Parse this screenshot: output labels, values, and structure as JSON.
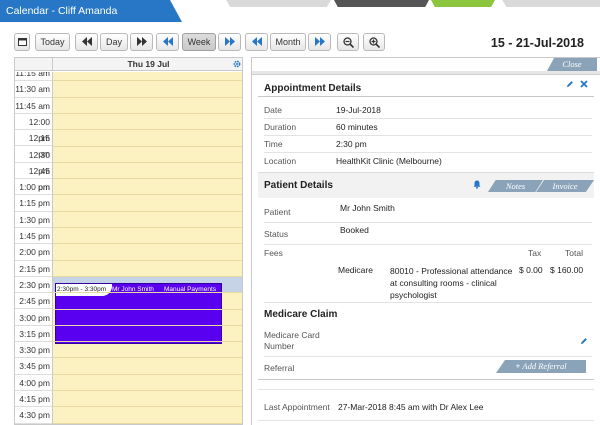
{
  "header": {
    "title": "Calendar - Cliff Amanda"
  },
  "toolbar": {
    "today_label": "Today",
    "day_label": "Day",
    "week_label": "Week",
    "month_label": "Month",
    "date_range": "15 - 21-Jul-2018"
  },
  "calendar": {
    "day_header": "Thu 19 Jul",
    "times": [
      "11:15 am",
      "11:30 am",
      "11:45 am",
      "12:00 pm",
      "12:15 pm",
      "12:30 pm",
      "12:45 pm",
      "1:00 pm",
      "1:15 pm",
      "1:30 pm",
      "1:45 pm",
      "2:00 pm",
      "2:15 pm",
      "2:30 pm",
      "2:45 pm",
      "3:00 pm",
      "3:15 pm",
      "3:30 pm",
      "3:45 pm",
      "4:00 pm",
      "4:15 pm",
      "4:30 pm"
    ],
    "appointment": {
      "time": "2:30pm - 3:30pm",
      "patient": "Mr John Smith",
      "payment": "Manual Payments",
      "color": "#5a00f0"
    }
  },
  "details": {
    "close_label": "Close",
    "appointment_title": "Appointment Details",
    "date_label": "Date",
    "date_value": "19-Jul-2018",
    "duration_label": "Duration",
    "duration_value": "60 minutes",
    "time_label": "Time",
    "time_value": "2:30 pm",
    "location_label": "Location",
    "location_value": "HealthKit Clinic (Melbourne)",
    "patient_title": "Patient Details",
    "notes_label": "Notes",
    "invoice_label": "Invoice",
    "patient_label": "Patient",
    "patient_value": "Mr John Smith",
    "status_label": "Status",
    "status_value": "Booked",
    "fees_label": "Fees",
    "tax_header": "Tax",
    "total_header": "Total",
    "fee_type": "Medicare",
    "fee_description": [
      "80010 - Professional attendance",
      "at consulting rooms - clinical",
      "psychologist"
    ],
    "fee_tax": "$ 0.00",
    "fee_total": "$ 160.00",
    "medicare_title": "Medicare Claim",
    "medicare_card_label": [
      "Medicare Card",
      "Number"
    ],
    "referral_label": "Referral",
    "add_referral_label": "Add Referral",
    "last_appt_label": "Last Appointment",
    "last_appt_value": "27-Mar-2018 8:45 am with Dr Alex Lee"
  },
  "colors": {
    "accent": "#2777c6",
    "calendar_bg": "#fcf1c0",
    "appointment": "#5a00f0",
    "tab": "#8aa3b9"
  }
}
